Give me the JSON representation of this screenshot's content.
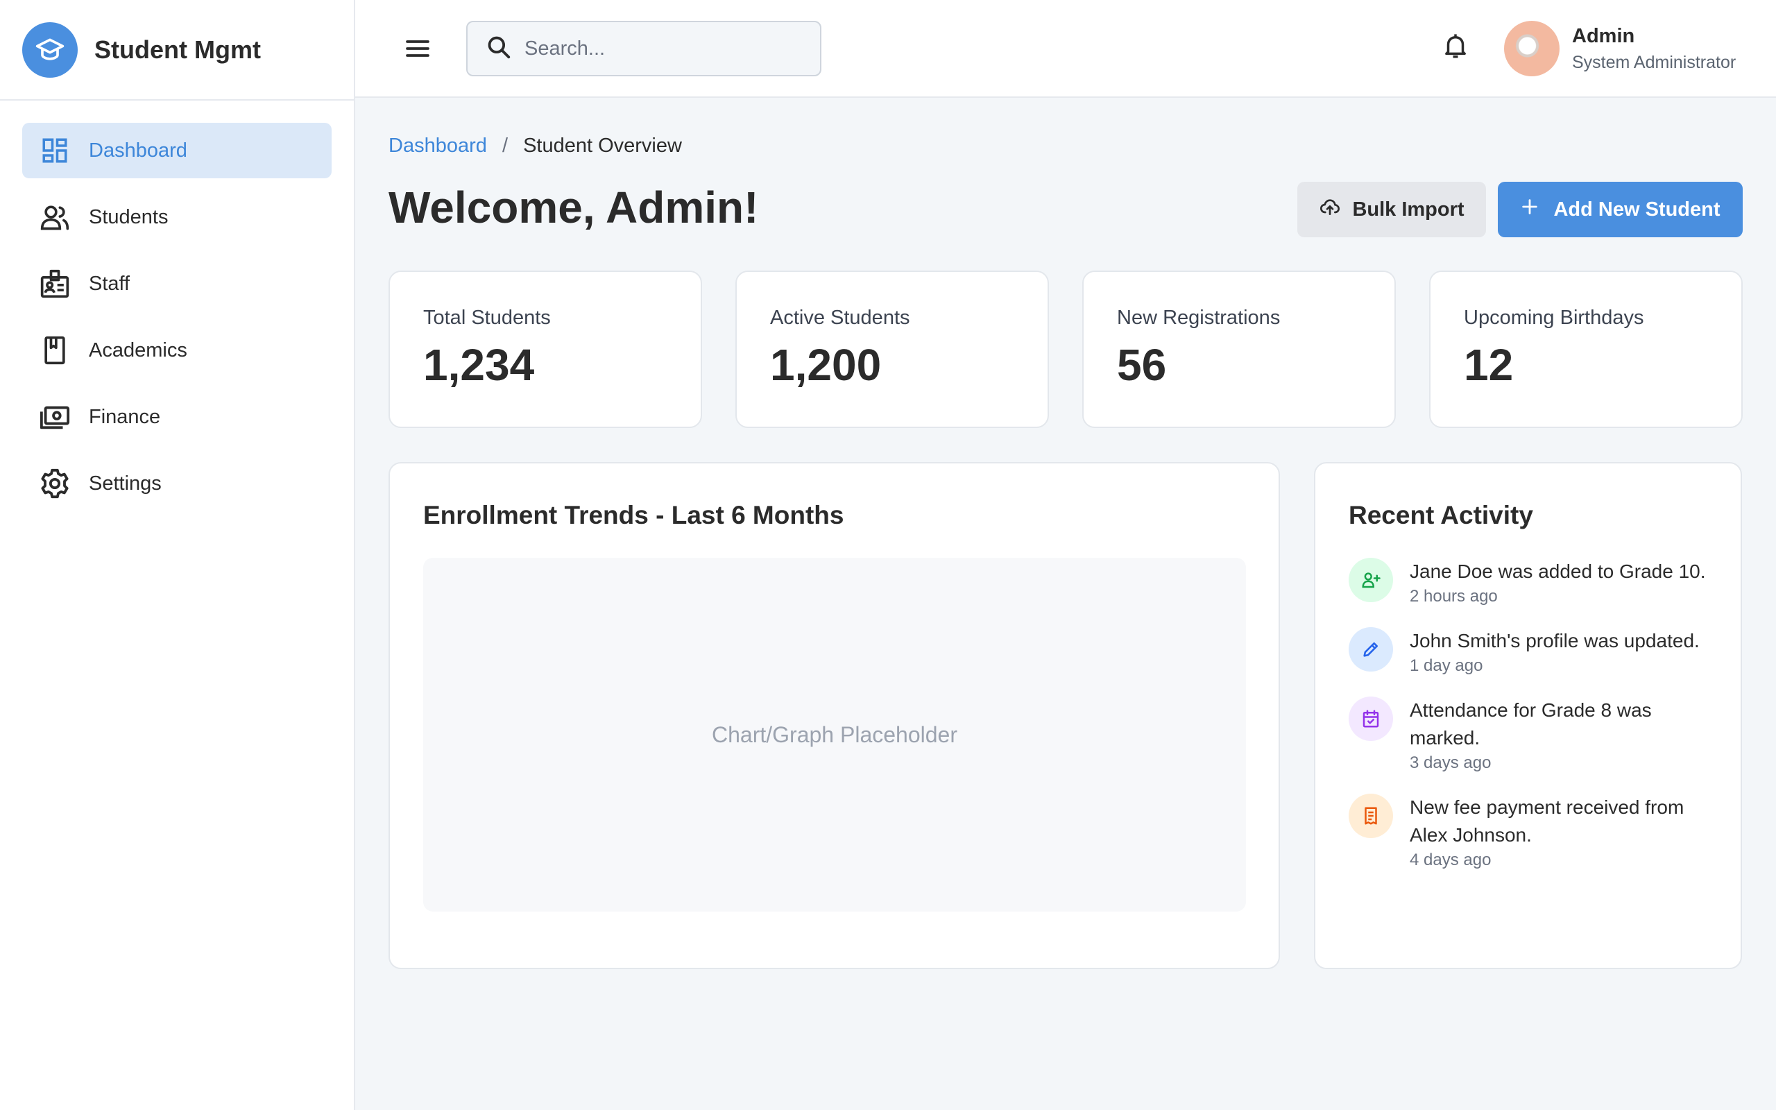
{
  "brand": {
    "name": "Student Mgmt"
  },
  "sidebar": {
    "items": [
      {
        "label": "Dashboard",
        "icon": "dashboard-icon",
        "active": true
      },
      {
        "label": "Students",
        "icon": "students-icon"
      },
      {
        "label": "Staff",
        "icon": "staff-badge-icon"
      },
      {
        "label": "Academics",
        "icon": "book-icon"
      },
      {
        "label": "Finance",
        "icon": "money-icon"
      },
      {
        "label": "Settings",
        "icon": "gear-icon"
      }
    ]
  },
  "header": {
    "search_placeholder": "Search...",
    "user_name": "Admin",
    "user_role": "System Administrator"
  },
  "breadcrumb": {
    "parent": "Dashboard",
    "separator": "/",
    "current": "Student Overview"
  },
  "page": {
    "title": "Welcome, Admin!",
    "bulk_import_label": "Bulk Import",
    "add_student_label": "Add New Student"
  },
  "stats": [
    {
      "label": "Total Students",
      "value": "1,234"
    },
    {
      "label": "Active Students",
      "value": "1,200"
    },
    {
      "label": "New Registrations",
      "value": "56"
    },
    {
      "label": "Upcoming Birthdays",
      "value": "12"
    }
  ],
  "enrollment": {
    "title": "Enrollment Trends - Last 6 Months",
    "placeholder": "Chart/Graph Placeholder"
  },
  "activity": {
    "title": "Recent Activity",
    "items": [
      {
        "text": "Jane Doe was added to Grade 10.",
        "time": "2 hours ago",
        "icon": "user-plus-icon",
        "color": "#16a34a",
        "bg": "#dcfce7"
      },
      {
        "text": "John Smith's profile was updated.",
        "time": "1 day ago",
        "icon": "pencil-icon",
        "color": "#2563eb",
        "bg": "#dbeafe"
      },
      {
        "text": "Attendance for Grade 8 was marked.",
        "time": "3 days ago",
        "icon": "calendar-check-icon",
        "color": "#9333ea",
        "bg": "#f3e8ff"
      },
      {
        "text": "New fee payment received from Alex Johnson.",
        "time": "4 days ago",
        "icon": "receipt-icon",
        "color": "#ea580c",
        "bg": "#ffedd5"
      }
    ]
  },
  "colors": {
    "accent": "#4a8fdf",
    "background": "#f3f6f9"
  }
}
